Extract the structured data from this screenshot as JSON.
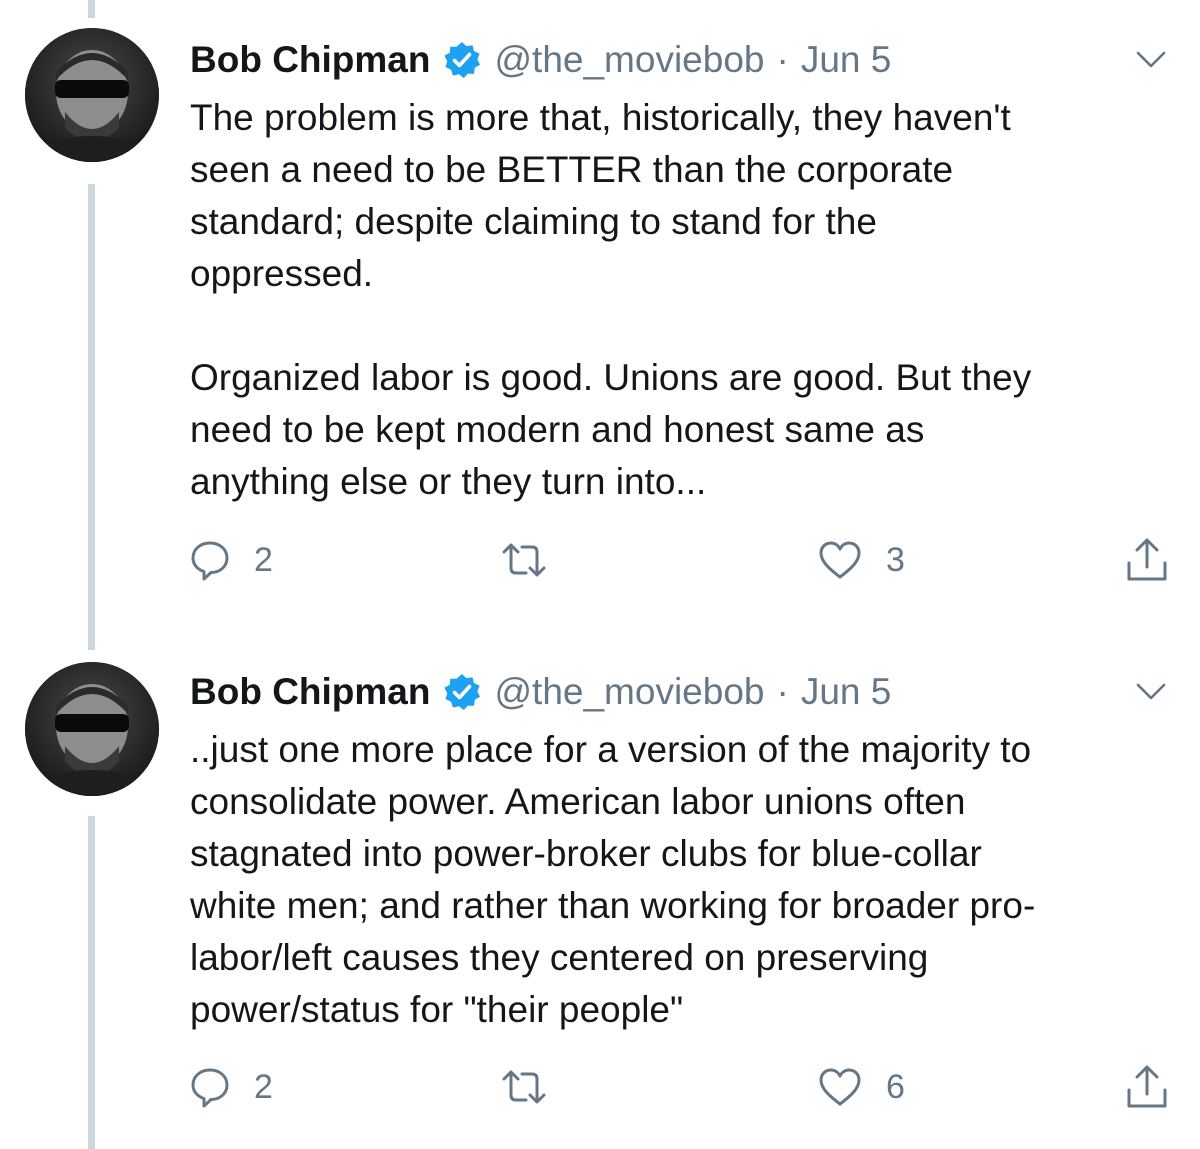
{
  "tweets": [
    {
      "display_name": "Bob Chipman",
      "verified": true,
      "handle": "@the_moviebob",
      "separator": "·",
      "date": "Jun 5",
      "text": "The problem is more that, historically, they haven't\nseen a need to be BETTER than the corporate\nstandard; despite claiming to stand for the\noppressed.\n\nOrganized labor is good. Unions are good. But they\nneed to be kept modern and honest same as\nanything else or they turn into...",
      "actions": {
        "replies": "2",
        "retweets": "",
        "likes": "3"
      }
    },
    {
      "display_name": "Bob Chipman",
      "verified": true,
      "handle": "@the_moviebob",
      "separator": "·",
      "date": "Jun 5",
      "text": "..just one more place for a version of the majority to\nconsolidate power. American labor unions often\nstagnated into power-broker clubs for blue-collar\nwhite men; and rather than working for broader pro-\nlabor/left causes they centered on preserving\npower/status for \"their people\"",
      "actions": {
        "replies": "2",
        "retweets": "",
        "likes": "6"
      }
    }
  ],
  "icons": {
    "verified": "verified-badge-icon",
    "caret": "chevron-down-icon",
    "reply": "reply-bubble-icon",
    "retweet": "retweet-icon",
    "like": "heart-icon",
    "share": "share-icon"
  },
  "colors": {
    "text": "#14171a",
    "secondary": "#657786",
    "verified": "#1da1f2",
    "thread_line": "#ccd6dd"
  }
}
